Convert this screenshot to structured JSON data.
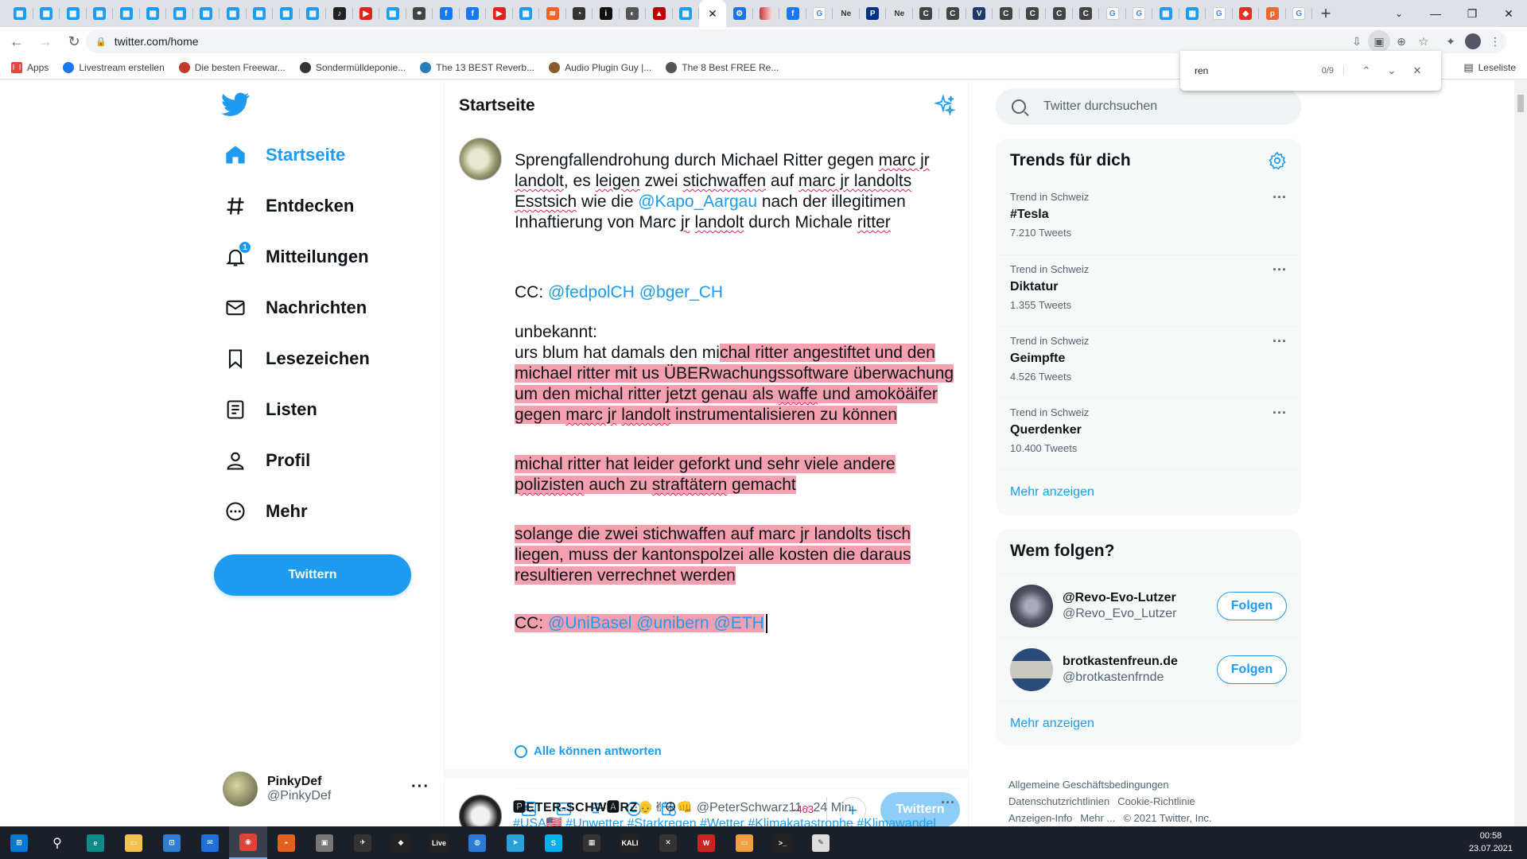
{
  "browser": {
    "tab_icons": [
      "twitter",
      "twitter",
      "twitter",
      "twitter",
      "twitter",
      "twitter",
      "twitter",
      "twitter",
      "twitter",
      "twitter",
      "twitter",
      "twitter",
      "music",
      "youtube",
      "twitter",
      "link",
      "facebook",
      "facebook",
      "youtube",
      "twitter",
      "rss",
      "clock",
      "info",
      "moon",
      "warning",
      "twitter",
      "active",
      "gear",
      "gradient",
      "facebook",
      "google",
      "ne",
      "paypal",
      "ne",
      "c",
      "c",
      "v",
      "c",
      "c",
      "c",
      "c",
      "google",
      "google",
      "twitter",
      "twitter",
      "google",
      "shield",
      "p",
      "google"
    ],
    "ne_label": "Ne",
    "url": "twitter.com/home",
    "bookmarks": [
      {
        "label": "Apps",
        "icon": "apps-grid-icon",
        "color": "#e8453c"
      },
      {
        "label": "Livestream erstellen",
        "icon": "facebook-icon",
        "color": "#1877f2"
      },
      {
        "label": "Die besten Freewar...",
        "icon": "star-icon",
        "color": "#c0392b"
      },
      {
        "label": "Sondermülldeponie...",
        "icon": "w-icon",
        "color": "#333333"
      },
      {
        "label": "The 13 BEST Reverb...",
        "icon": "m-icon",
        "color": "#2b7bb9"
      },
      {
        "label": "Audio Plugin Guy |...",
        "icon": "guy-icon",
        "color": "#8b5a2b"
      },
      {
        "label": "The 8 Best FREE Re...",
        "icon": "moon-icon",
        "color": "#555555"
      }
    ],
    "reading_list": "Leseliste",
    "find": {
      "value": "ren",
      "count": "0/9"
    }
  },
  "nav": {
    "items": [
      {
        "label": "Startseite",
        "icon": "home-icon"
      },
      {
        "label": "Entdecken",
        "icon": "hashtag-icon"
      },
      {
        "label": "Mitteilungen",
        "icon": "bell-icon",
        "badge": "1"
      },
      {
        "label": "Nachrichten",
        "icon": "mail-icon"
      },
      {
        "label": "Lesezeichen",
        "icon": "bookmark-icon"
      },
      {
        "label": "Listen",
        "icon": "list-icon"
      },
      {
        "label": "Profil",
        "icon": "person-icon"
      },
      {
        "label": "Mehr",
        "icon": "more-circle-icon"
      }
    ],
    "tweet_button": "Twittern",
    "account": {
      "name": "PinkyDef",
      "handle": "@PinkyDef"
    }
  },
  "main": {
    "title": "Startseite",
    "composer": {
      "counter": "-463",
      "reply_setting": "Alle können antworten",
      "send_label": "Twittern",
      "t1a": "Sprengfallendrohung durch Michael Ritter gegen ",
      "t1b": "marc jr",
      "t1c": " ",
      "t1d": "landolt",
      "t1e": ", es ",
      "t1f": "leigen",
      "t1g": " zwei ",
      "t1h": "stichwaffen",
      "t1i": " auf ",
      "t1j": "marc jr landolts",
      "t1k": " ",
      "t1l": "Esstsich",
      "t1m": " wie die ",
      "t1n": "@Kapo_Aargau",
      "t1o": " nach der illegitimen Inhaftierung von Marc ",
      "t1p": "jr",
      "t1q": " ",
      "t1r": "landolt",
      "t1s": " durch Michale ",
      "t1t": "ritter",
      "cc1a": "CC: ",
      "cc1b": "@fedpolCH",
      "cc1c": " ",
      "cc1d": "@bger_CH",
      "unk": "unbekannt:",
      "p1a": "urs blum hat damals den mi",
      "p1b": "chal ritter angestiftet und den michael ritter mit us ÜBERwachungssoftware überwachung um den michal ritter jetzt genau als ",
      "p1c": "waffe",
      "p1d": " und amoköäifer gegen ",
      "p1e": "marc jr",
      "p1f": " ",
      "p1g": "landolt",
      "p1h": " instrumentalisieren zu können",
      "p2a": "michal ritter hat leider geforkt und sehr viele andere ",
      "p2b": "polizisten",
      "p2c": " auch zu ",
      "p2d": "straftätern",
      "p2e": " gemacht",
      "p3a": "solange die zwei stichwaffen auf marc jr landolts tisch liegen, muss der kantonspolzei alle kosten die daraus resultieren verrechnet werden",
      "cc2a": "CC: ",
      "cc2b": "@UniBasel",
      "cc2c": " ",
      "cc2d": "@unibern",
      "cc2e": " ",
      "cc2f": "@ETH"
    },
    "next_tweet": {
      "name": "🅿ETER-SCHW🅰RZ👴✌☮👊",
      "handle": "@PeterSchwarz11",
      "time": "· 24 Min.",
      "body": "#USA🇺🇸 #Unwetter #Starkregen #Wetter #Klimakatastrophe #Klimawandel"
    }
  },
  "right": {
    "search_placeholder": "Twitter durchsuchen",
    "trends_title": "Trends für dich",
    "trends": [
      {
        "context": "Trend in Schweiz",
        "name": "#Tesla",
        "count": "7.210 Tweets"
      },
      {
        "context": "Trend in Schweiz",
        "name": "Diktatur",
        "count": "1.355 Tweets"
      },
      {
        "context": "Trend in Schweiz",
        "name": "Geimpfte",
        "count": "4.526 Tweets"
      },
      {
        "context": "Trend in Schweiz",
        "name": "Querdenker",
        "count": "10.400 Tweets"
      }
    ],
    "trends_more": "Mehr anzeigen",
    "follow_title": "Wem folgen?",
    "follow": [
      {
        "name": "@Revo-Evo-Lutzer",
        "handle": "@Revo_Evo_Lutzer",
        "button": "Folgen"
      },
      {
        "name": "brotkastenfreun.de",
        "handle": "@brotkastenfrnde",
        "button": "Folgen"
      }
    ],
    "follow_more": "Mehr anzeigen",
    "footer": {
      "terms": "Allgemeine Geschäftsbedingungen",
      "privacy": "Datenschutzrichtlinien",
      "cookies": "Cookie-Richtlinie",
      "ads": "Anzeigen-Info",
      "more": "Mehr ...",
      "copyright": "© 2021 Twitter, Inc."
    }
  },
  "taskbar": {
    "time": "00:58",
    "date": "23.07.2021",
    "live_label": "Live",
    "kali_label": "KALI"
  },
  "colors": {
    "accent": "#1d9bf0",
    "highlight": "#f4a0ae",
    "error": "#e0245e"
  }
}
